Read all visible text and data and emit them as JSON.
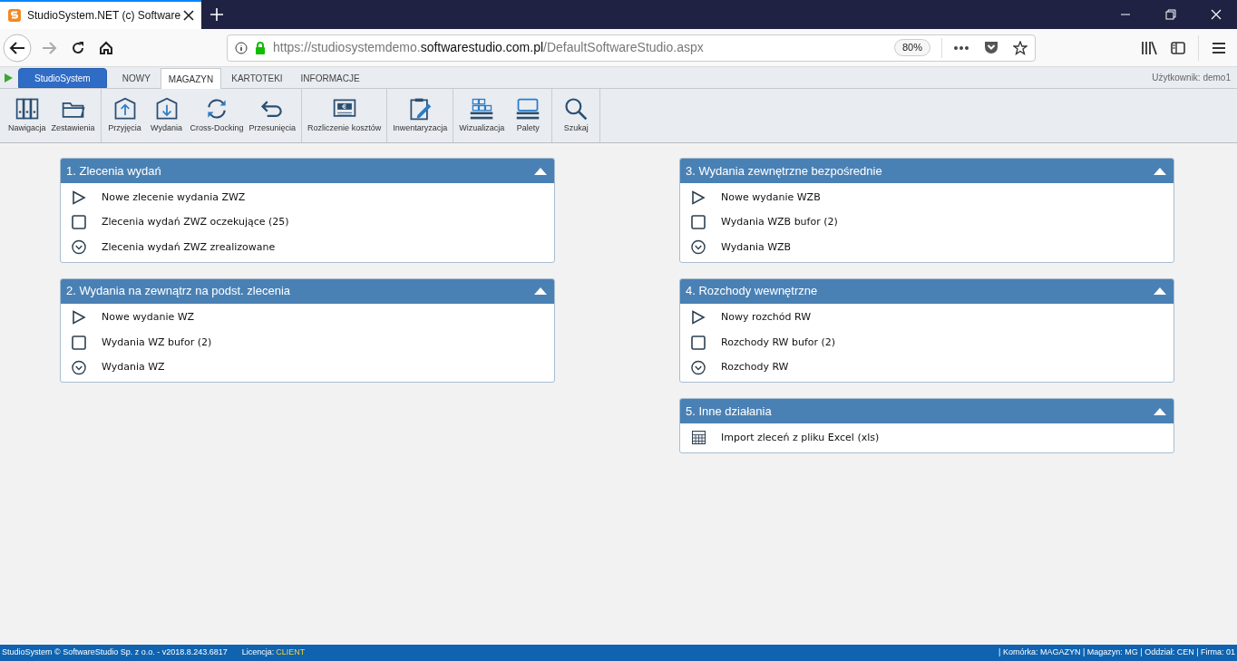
{
  "browser": {
    "tab_title": "StudioSystem.NET (c) Software",
    "url": [
      {
        "text": "https://studiosystemdemo.",
        "emphasis": false
      },
      {
        "text": "softwarestudio.com.pl",
        "emphasis": true
      },
      {
        "text": "/DefaultSoftwareStudio.aspx",
        "emphasis": false
      }
    ],
    "zoom": "80%"
  },
  "app_tabs": [
    {
      "label": "StudioSystem",
      "kind": "app",
      "selected": false
    },
    {
      "label": "NOWY",
      "kind": "tab",
      "selected": false
    },
    {
      "label": "MAGAZYN",
      "kind": "tab",
      "selected": true
    },
    {
      "label": "KARTOTEKI",
      "kind": "tab",
      "selected": false
    },
    {
      "label": "INFORMACJE",
      "kind": "tab",
      "selected": false
    }
  ],
  "user": "Użytkownik: demo1",
  "ribbon": {
    "groups": [
      [
        {
          "label": "Nawigacja",
          "kind": "binders"
        },
        {
          "label": "Zestawienia",
          "kind": "folder"
        }
      ],
      [
        {
          "label": "Przyjęcia",
          "kind": "inbound"
        },
        {
          "label": "Wydania",
          "kind": "outbound"
        },
        {
          "label": "Cross-Docking",
          "kind": "sync"
        },
        {
          "label": "Przesunięcia",
          "kind": "undo"
        }
      ],
      [
        {
          "label": "Rozliczenie kosztów",
          "kind": "money"
        }
      ],
      [
        {
          "label": "Inwentaryzacja",
          "kind": "clipboard"
        }
      ],
      [
        {
          "label": "Wizualizacja",
          "kind": "boxes"
        },
        {
          "label": "Palety",
          "kind": "pallet"
        }
      ],
      [
        {
          "label": "Szukaj",
          "kind": "search"
        }
      ]
    ]
  },
  "panels": {
    "left": [
      {
        "title": "1. Zlecenia wydań",
        "expanded": true,
        "items": [
          {
            "label": "Nowe zlecenie wydania ZWZ",
            "kind": "new"
          },
          {
            "label": "Zlecenia wydań ZWZ oczekujące (25)",
            "kind": "buffer"
          },
          {
            "label": "Zlecenia wydań ZWZ zrealizowane",
            "kind": "done"
          }
        ]
      },
      {
        "title": "2. Wydania na zewnątrz na podst. zlecenia",
        "expanded": true,
        "items": [
          {
            "label": "Nowe wydanie WZ",
            "kind": "new"
          },
          {
            "label": "Wydania WZ bufor (2)",
            "kind": "buffer"
          },
          {
            "label": "Wydania WZ",
            "kind": "done"
          }
        ]
      }
    ],
    "right": [
      {
        "title": "3. Wydania zewnętrzne bezpośrednie",
        "expanded": true,
        "items": [
          {
            "label": "Nowe wydanie WZB",
            "kind": "new"
          },
          {
            "label": "Wydania WZB bufor (2)",
            "kind": "buffer"
          },
          {
            "label": "Wydania WZB",
            "kind": "done"
          }
        ]
      },
      {
        "title": "4. Rozchody wewnętrzne",
        "expanded": true,
        "items": [
          {
            "label": "Nowy rozchód RW",
            "kind": "new"
          },
          {
            "label": "Rozchody RW bufor (2)",
            "kind": "buffer"
          },
          {
            "label": "Rozchody RW",
            "kind": "done"
          }
        ]
      },
      {
        "title": "5. Inne działania",
        "expanded": true,
        "items": [
          {
            "label": "Import zleceń z pliku Excel (xls)",
            "kind": "import"
          }
        ]
      }
    ]
  },
  "status_bar": {
    "copyright": "StudioSystem © SoftwareStudio Sp. z o.o. - v2018.8.243.6817",
    "license_label": "Licencja:",
    "license_value": "CLIENT",
    "context": "| Komórka: MAGAZYN | Magazyn: MG | Oddział: CEN | Firma: 01"
  }
}
